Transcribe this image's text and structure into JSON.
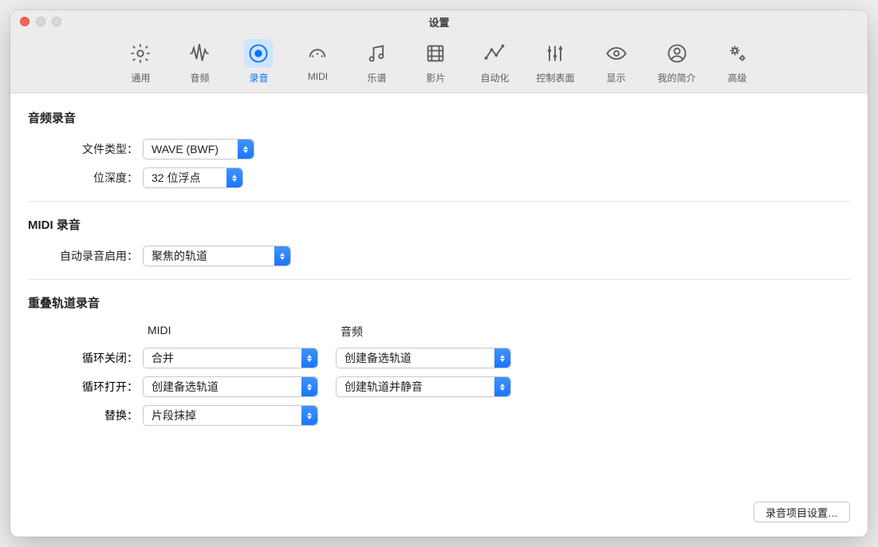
{
  "window": {
    "title": "设置"
  },
  "tabs": [
    {
      "id": "general",
      "label": "通用"
    },
    {
      "id": "audio",
      "label": "音频"
    },
    {
      "id": "record",
      "label": "录音",
      "selected": true
    },
    {
      "id": "midi",
      "label": "MIDI"
    },
    {
      "id": "score",
      "label": "乐谱"
    },
    {
      "id": "movie",
      "label": "影片"
    },
    {
      "id": "auto",
      "label": "自动化"
    },
    {
      "id": "csurf",
      "label": "控制表面"
    },
    {
      "id": "display",
      "label": "显示"
    },
    {
      "id": "profile",
      "label": "我的简介"
    },
    {
      "id": "advanced",
      "label": "高级"
    }
  ],
  "audioRecording": {
    "title": "音频录音",
    "fileType": {
      "label": "文件类型：",
      "value": "WAVE (BWF)"
    },
    "bitDepth": {
      "label": "位深度：",
      "value": "32 位浮点"
    }
  },
  "midiRecording": {
    "title": "MIDI 录音",
    "autoRecord": {
      "label": "自动录音启用：",
      "value": "聚焦的轨道"
    }
  },
  "overlap": {
    "title": "重叠轨道录音",
    "columns": {
      "midi": "MIDI",
      "audio": "音频"
    },
    "loopOff": {
      "label": "循环关闭：",
      "midi": "合并",
      "audio": "创建备选轨道"
    },
    "loopOn": {
      "label": "循环打开：",
      "midi": "创建备选轨道",
      "audio": "创建轨道并静音"
    },
    "replace": {
      "label": "替换：",
      "midi": "片段抹掉"
    }
  },
  "footer": {
    "projectSettings": "录音项目设置…"
  }
}
